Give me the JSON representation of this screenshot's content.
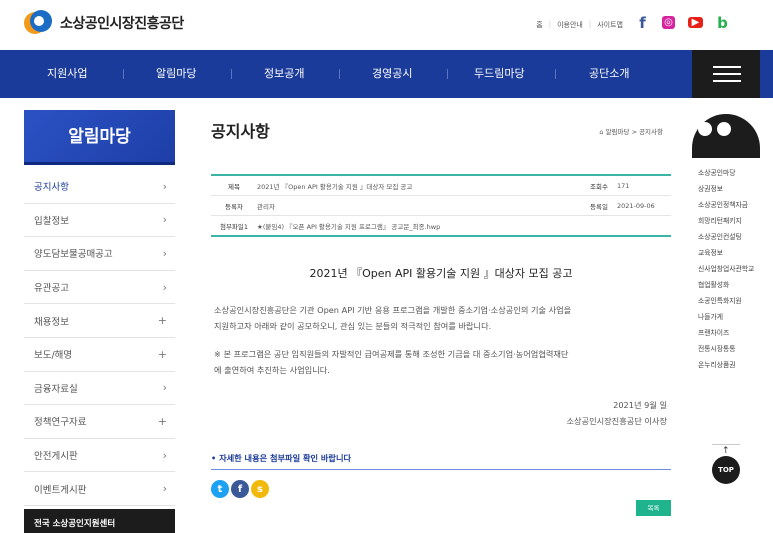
{
  "header": {
    "logo_text": "소상공인시장진흥공단",
    "util_links": [
      "홈",
      "이용안내",
      "사이트맵"
    ],
    "sns_icons": [
      "facebook-icon",
      "instagram-icon",
      "youtube-icon",
      "blog-icon"
    ]
  },
  "gnb": {
    "items": [
      "지원사업",
      "알림마당",
      "정보공개",
      "경영공시",
      "두드림마당",
      "공단소개"
    ]
  },
  "lnb": {
    "title": "알림마당",
    "items": [
      {
        "label": "공지사항",
        "marker": "›",
        "active": true
      },
      {
        "label": "입찰정보",
        "marker": "›"
      },
      {
        "label": "양도담보물공매공고",
        "marker": "›"
      },
      {
        "label": "유관공고",
        "marker": "›"
      },
      {
        "label": "채용정보",
        "marker": "+"
      },
      {
        "label": "보도/해명",
        "marker": "+"
      },
      {
        "label": "금융자료실",
        "marker": "›"
      },
      {
        "label": "정책연구자료",
        "marker": "+"
      },
      {
        "label": "안전게시판",
        "marker": "›"
      },
      {
        "label": "이벤트게시판",
        "marker": "›"
      }
    ],
    "center_label": "전국 소상공인지원센터"
  },
  "page": {
    "title": "공지사항",
    "breadcrumb": "알림마당 > 공지사항"
  },
  "post": {
    "labels": {
      "title": "제목",
      "author": "등록자",
      "attach": "첨부파일1",
      "views": "조회수",
      "date": "등록일"
    },
    "title": "2021년 『Open API 활용기술 지원 』대상자 모집 공고",
    "author": "관리자",
    "views": "171",
    "date": "2021-09-06",
    "attachment": "★(붙임4) 『오픈 API 활용기술 지원 프로그램』 공고문_최종.hwp",
    "heading": "2021년 『Open API 활용기술 지원 』대상자 모집 공고",
    "para1_line1": "소상공인시장진흥공단은 기관 Open API 기반 응용 프로그램을 개발한 중소기업·소상공인의 기술 사업을",
    "para1_line2": "지원하고자 아래와 같이 공모하오니, 관심 있는 분들의 적극적인 참여를 바랍니다.",
    "para2_line1": "※ 본 프로그램은 공단 임직원들의 자발적인 급여공제를 통해 조성한 기금을 대 중소기업·농어업협력재단",
    "para2_line2": "에 출연하여 추진하는 사업입니다.",
    "sign_date": "2021년 9월 일",
    "sign_org": "소상공인시장진흥공단 이사장",
    "more_text": "• 자세한 내용은 첨부파일 확인 바랍니다",
    "share_icons": [
      "twitter-icon",
      "facebook-icon",
      "kakaostory-icon"
    ],
    "list_button": "목록"
  },
  "quick": {
    "items": [
      "소상공인마당",
      "상권정보",
      "소상공인정책자금",
      "희망리턴패키지",
      "소상공인컨설팅",
      "교육정보",
      "신사업창업사관학교",
      "협업활성화",
      "소공인특화지원",
      "나들가게",
      "프랜차이즈",
      "전통시장통통",
      "온누리상품권"
    ],
    "top_label": "TOP"
  },
  "colors": {
    "nav": "#1b3b9a",
    "accent": "#3bb5a5",
    "button": "#1fb48e",
    "dark": "#1c1c1c"
  }
}
